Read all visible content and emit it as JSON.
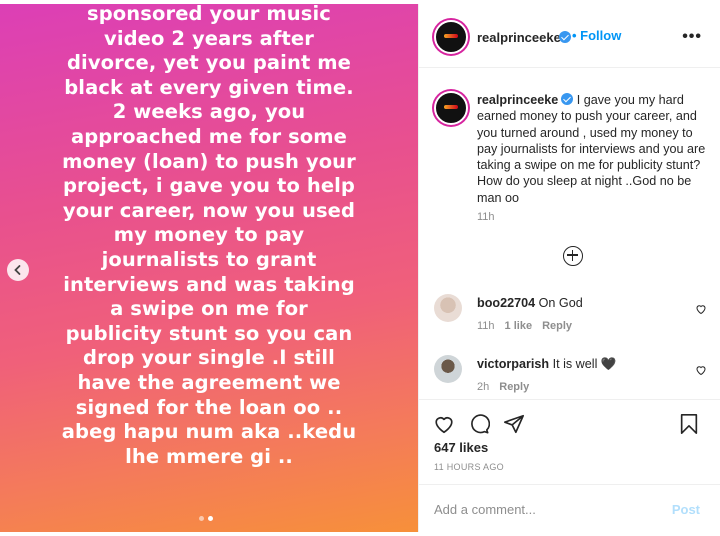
{
  "media": {
    "text": "sponsored your music\nvideo 2 years after\ndivorce, yet you paint me\nblack at every given time.\n2 weeks ago, you\napproached me for some\nmoney (loan) to push your\nproject, i gave you to help\nyour career, now you used\nmy money to pay\njournalists to grant\ninterviews and was taking\na swipe on me for\npublicity stunt so you can\ndrop your single .I still\nhave the agreement we\nsigned for the loan oo ..\nabeg hapu num aka ..kedu\nlhe mmere gi ..",
    "gradient_colors": [
      "#dc3fb6",
      "#f0607a",
      "#f7903a"
    ]
  },
  "header": {
    "username": "realprinceeke",
    "follow_label": "Follow",
    "more_label": "•••"
  },
  "caption": {
    "username": "realprinceeke",
    "text": "I gave you my hard earned money to push your career, and you turned around , used my money to pay journalists for interviews and you are taking a swipe on me for publicity stunt? How do you sleep at night ..God no be man oo",
    "time": "11h"
  },
  "comments": [
    {
      "username": "boo22704",
      "text": "On God",
      "time": "11h",
      "likes": "1 like",
      "reply": "Reply"
    },
    {
      "username": "victorparish",
      "text": "It is well 🖤",
      "time": "2h",
      "reply": "Reply"
    }
  ],
  "stats": {
    "likes": "647 likes",
    "date": "11 HOURS AGO"
  },
  "add_comment": {
    "placeholder": "Add a comment...",
    "post_label": "Post"
  },
  "colors": {
    "accent": "#0095f6",
    "verified": "#3897f0",
    "post_disabled": "#b2dffc"
  }
}
